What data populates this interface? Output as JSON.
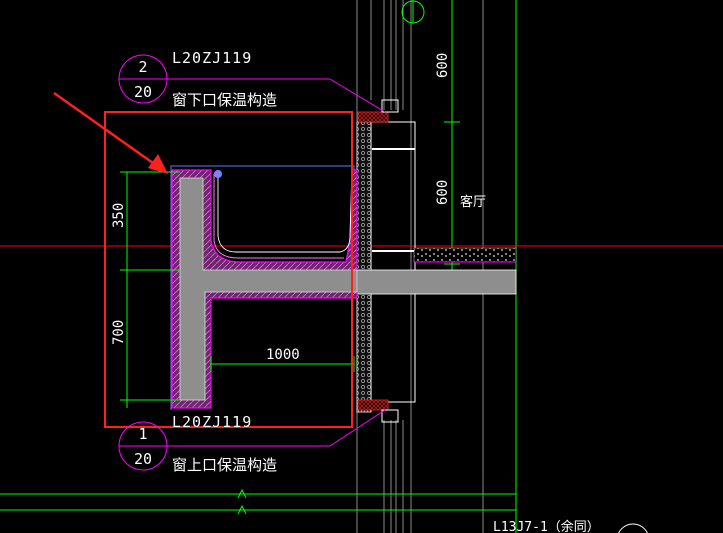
{
  "callouts": {
    "top": {
      "ref": "L20ZJ119",
      "number": "2",
      "sheet": "20",
      "title": "窗下口保温构造"
    },
    "bottom": {
      "ref": "L20ZJ119",
      "number": "1",
      "sheet": "20",
      "title": "窗上口保温构造"
    }
  },
  "dimensions": {
    "upper_height": "350",
    "lower_height": "700",
    "width": "1000",
    "right_top": "600",
    "right_mid": "600"
  },
  "room_label": "客厅",
  "bottom_ref": "L13J7-1（余同）",
  "colors": {
    "background": "#000000",
    "highlight_box": "#ff2020",
    "insulation": "#ff00ff",
    "concrete": "#909090",
    "dimension": "#00ff00",
    "axis": "#ff0000",
    "callout_circle": "#ff00ff"
  }
}
